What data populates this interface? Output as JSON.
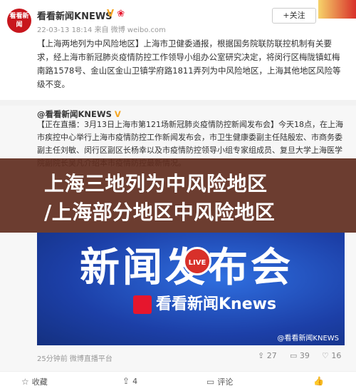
{
  "post": {
    "avatar_text": "看看新闻",
    "author": "看看新闻KNEWS",
    "meta": "22-03-13 18:14 来自 微博 weibo.com",
    "follow_label": "+关注",
    "text": "【上海两地列为中风险地区】上海市卫健委通报，根据国务院联防联控机制有关要求，经上海市新冠肺炎疫情防控工作领导小组办公室研究决定，将闵行区梅陇镇虹梅南路1578号、金山区金山卫镇学府路1811弄列为中风险地区，上海其他地区风险等级不变。"
  },
  "repost": {
    "author": "@看看新闻KNEWS",
    "text": "【正在直播：3月13日上海市第121场新冠肺炎疫情防控新闻发布会】今天18点，在上海市疾控中心举行上海市疫情防控工作新闻发布会，市卫生健康委副主任陆殷宏、市商务委副主任刘敏、闵行区副区长杨幸以及市疫情防控领导小组专家组成员、复旦大学上海医学院副院长吴凡介绍本市疫情防控最新情况。",
    "overlay_line1": "上海三地列为中风险地区",
    "overlay_line2": "/上海部分地区中风险地区",
    "video": {
      "title": "新闻发布会",
      "live_label": "LIVE",
      "logo_text": "看看新闻Knews",
      "watermark": "@看看新闻KNEWS"
    },
    "footer": {
      "time_source": "25分钟前 微博直播平台",
      "forward_count": "27",
      "comment_count": "39",
      "like_count": "16"
    }
  },
  "bottom_bar": {
    "favorite": "收藏",
    "comment": "评论",
    "forward_count": "4"
  }
}
